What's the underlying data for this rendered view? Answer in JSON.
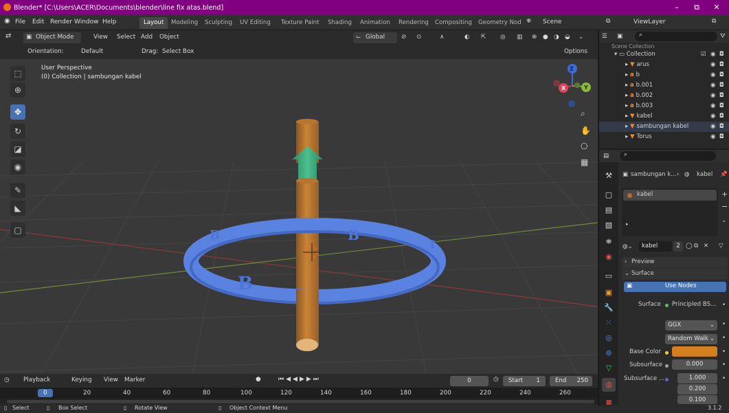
{
  "window": {
    "title": "Blender* [C:\\Users\\ACER\\Documents\\blender\\line fix atas.blend]",
    "min": "–",
    "max": "⧉",
    "close": "✕"
  },
  "menu": [
    "File",
    "Edit",
    "Render",
    "Window",
    "Help"
  ],
  "workspaces": [
    "Layout",
    "Modeling",
    "Sculpting",
    "UV Editing",
    "Texture Paint",
    "Shading",
    "Animation",
    "Rendering",
    "Compositing",
    "Geometry Nod"
  ],
  "scene": {
    "label": "Scene",
    "view_layer": "ViewLayer"
  },
  "viewport_header": {
    "mode": "Object Mode",
    "menus": [
      "View",
      "Select",
      "Add",
      "Object"
    ],
    "transform": "Global",
    "options": "Options"
  },
  "tool_header": {
    "orientation_label": "Orientation:",
    "orientation_value": "Default",
    "drag_label": "Drag:",
    "drag_value": "Select Box"
  },
  "overlay": {
    "perspective": "User Perspective",
    "collection": "(0) Collection | sambungan kabel"
  },
  "gizmo": {
    "z": "Z",
    "y": "Y",
    "x": "X"
  },
  "outliner": {
    "search_placeholder": "",
    "scene_collection": "Scene Collection",
    "collection": "Collection",
    "items": [
      {
        "name": "arus",
        "icon": "mesh-icon"
      },
      {
        "name": "b",
        "icon": "text-icon"
      },
      {
        "name": "b.001",
        "icon": "text-icon"
      },
      {
        "name": "b.002",
        "icon": "text-icon"
      },
      {
        "name": "b.003",
        "icon": "text-icon"
      },
      {
        "name": "kabel",
        "icon": "mesh-icon"
      },
      {
        "name": "sambungan kabel",
        "icon": "mesh-icon",
        "selected": true
      },
      {
        "name": "Torus",
        "icon": "mesh-icon"
      }
    ]
  },
  "properties": {
    "breadcrumb_object": "sambungan k...",
    "breadcrumb_material": "kabel",
    "slot": "kabel",
    "material_name": "kabel",
    "users": "2",
    "preview_label": "Preview",
    "surface_label": "Surface",
    "use_nodes": "Use Nodes",
    "surface_field_label": "Surface",
    "surface_value": "Principled BS...",
    "distribution": "GGX",
    "subsurface_method": "Random Walk",
    "base_color_label": "Base Color",
    "base_color": "#d2801f",
    "subsurface_label": "Subsurface",
    "subsurface_value": "0.000",
    "subsurface_radius_label": "Subsurface ...",
    "radius": [
      "1.000",
      "0.200",
      "0.100"
    ]
  },
  "timeline": {
    "menus": [
      "Playback",
      "Keying",
      "View",
      "Marker"
    ],
    "current_frame": "0",
    "start_label": "Start",
    "start": "1",
    "end_label": "End",
    "end": "250",
    "ruler": [
      "0",
      "20",
      "40",
      "60",
      "80",
      "100",
      "120",
      "140",
      "160",
      "180",
      "200",
      "220",
      "240",
      "260"
    ]
  },
  "status": {
    "select": "Select",
    "box_select": "Box Select",
    "rotate": "Rotate View",
    "context": "Object Context Menu",
    "version": "3.1.2"
  },
  "colors": {
    "accent": "#4772b3",
    "title_bar": "#800080",
    "torus": "#4a73d6",
    "cylinder": "#c47a30",
    "arrow": "#3fa57a"
  }
}
